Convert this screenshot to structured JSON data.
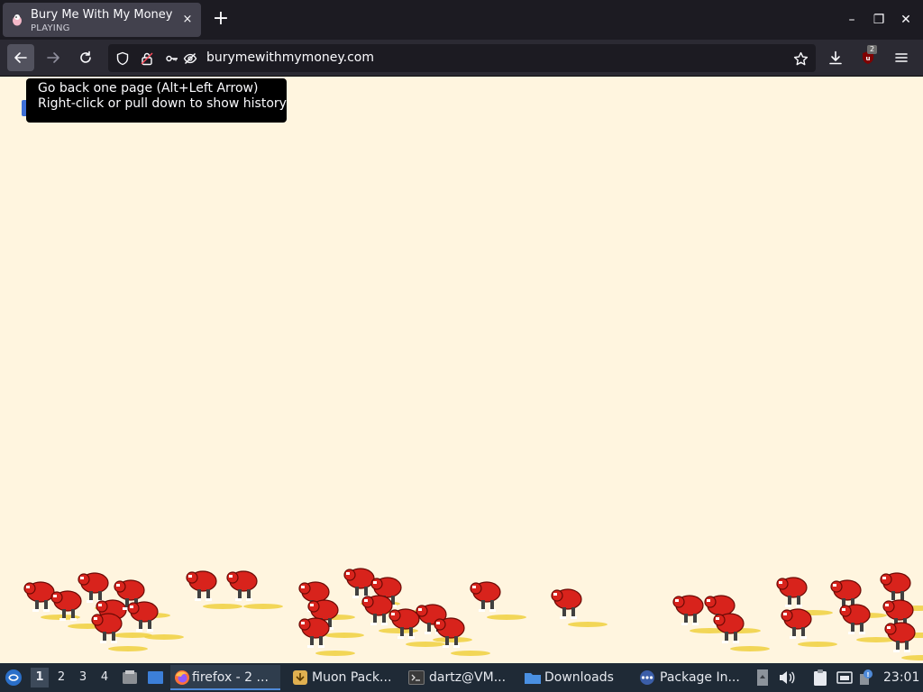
{
  "tab": {
    "title": "Bury Me With My Money",
    "subtitle": "PLAYING",
    "close_label": "×"
  },
  "new_tab_label": "+",
  "window_controls": {
    "minimize": "–",
    "maximize": "❐",
    "close": "✕"
  },
  "navbar": {
    "url": "burymewithmymoney.com",
    "extension_badge": "2"
  },
  "tooltip": {
    "line1": "Go back one page (Alt+Left Arrow)",
    "line2": "Right-click or pull down to show history"
  },
  "taskbar": {
    "workspaces": [
      "1",
      "2",
      "3",
      "4"
    ],
    "active_workspace": "1",
    "tasks": [
      {
        "label": "firefox - 2 ...",
        "icon": "firefox-icon",
        "active": true
      },
      {
        "label": "Muon Pack...",
        "icon": "package-icon",
        "active": false
      },
      {
        "label": "dartz@VM...",
        "icon": "terminal-icon",
        "active": false
      },
      {
        "label": "Downloads",
        "icon": "folder-icon",
        "active": false
      },
      {
        "label": "Package In...",
        "icon": "installer-icon",
        "active": false
      }
    ],
    "clock": "23:01"
  },
  "colors": {
    "page_background": "#fff5df",
    "character_red": "#d8231c",
    "coin_gold": "#f0d040",
    "accent_blue": "#4f8ad8"
  }
}
